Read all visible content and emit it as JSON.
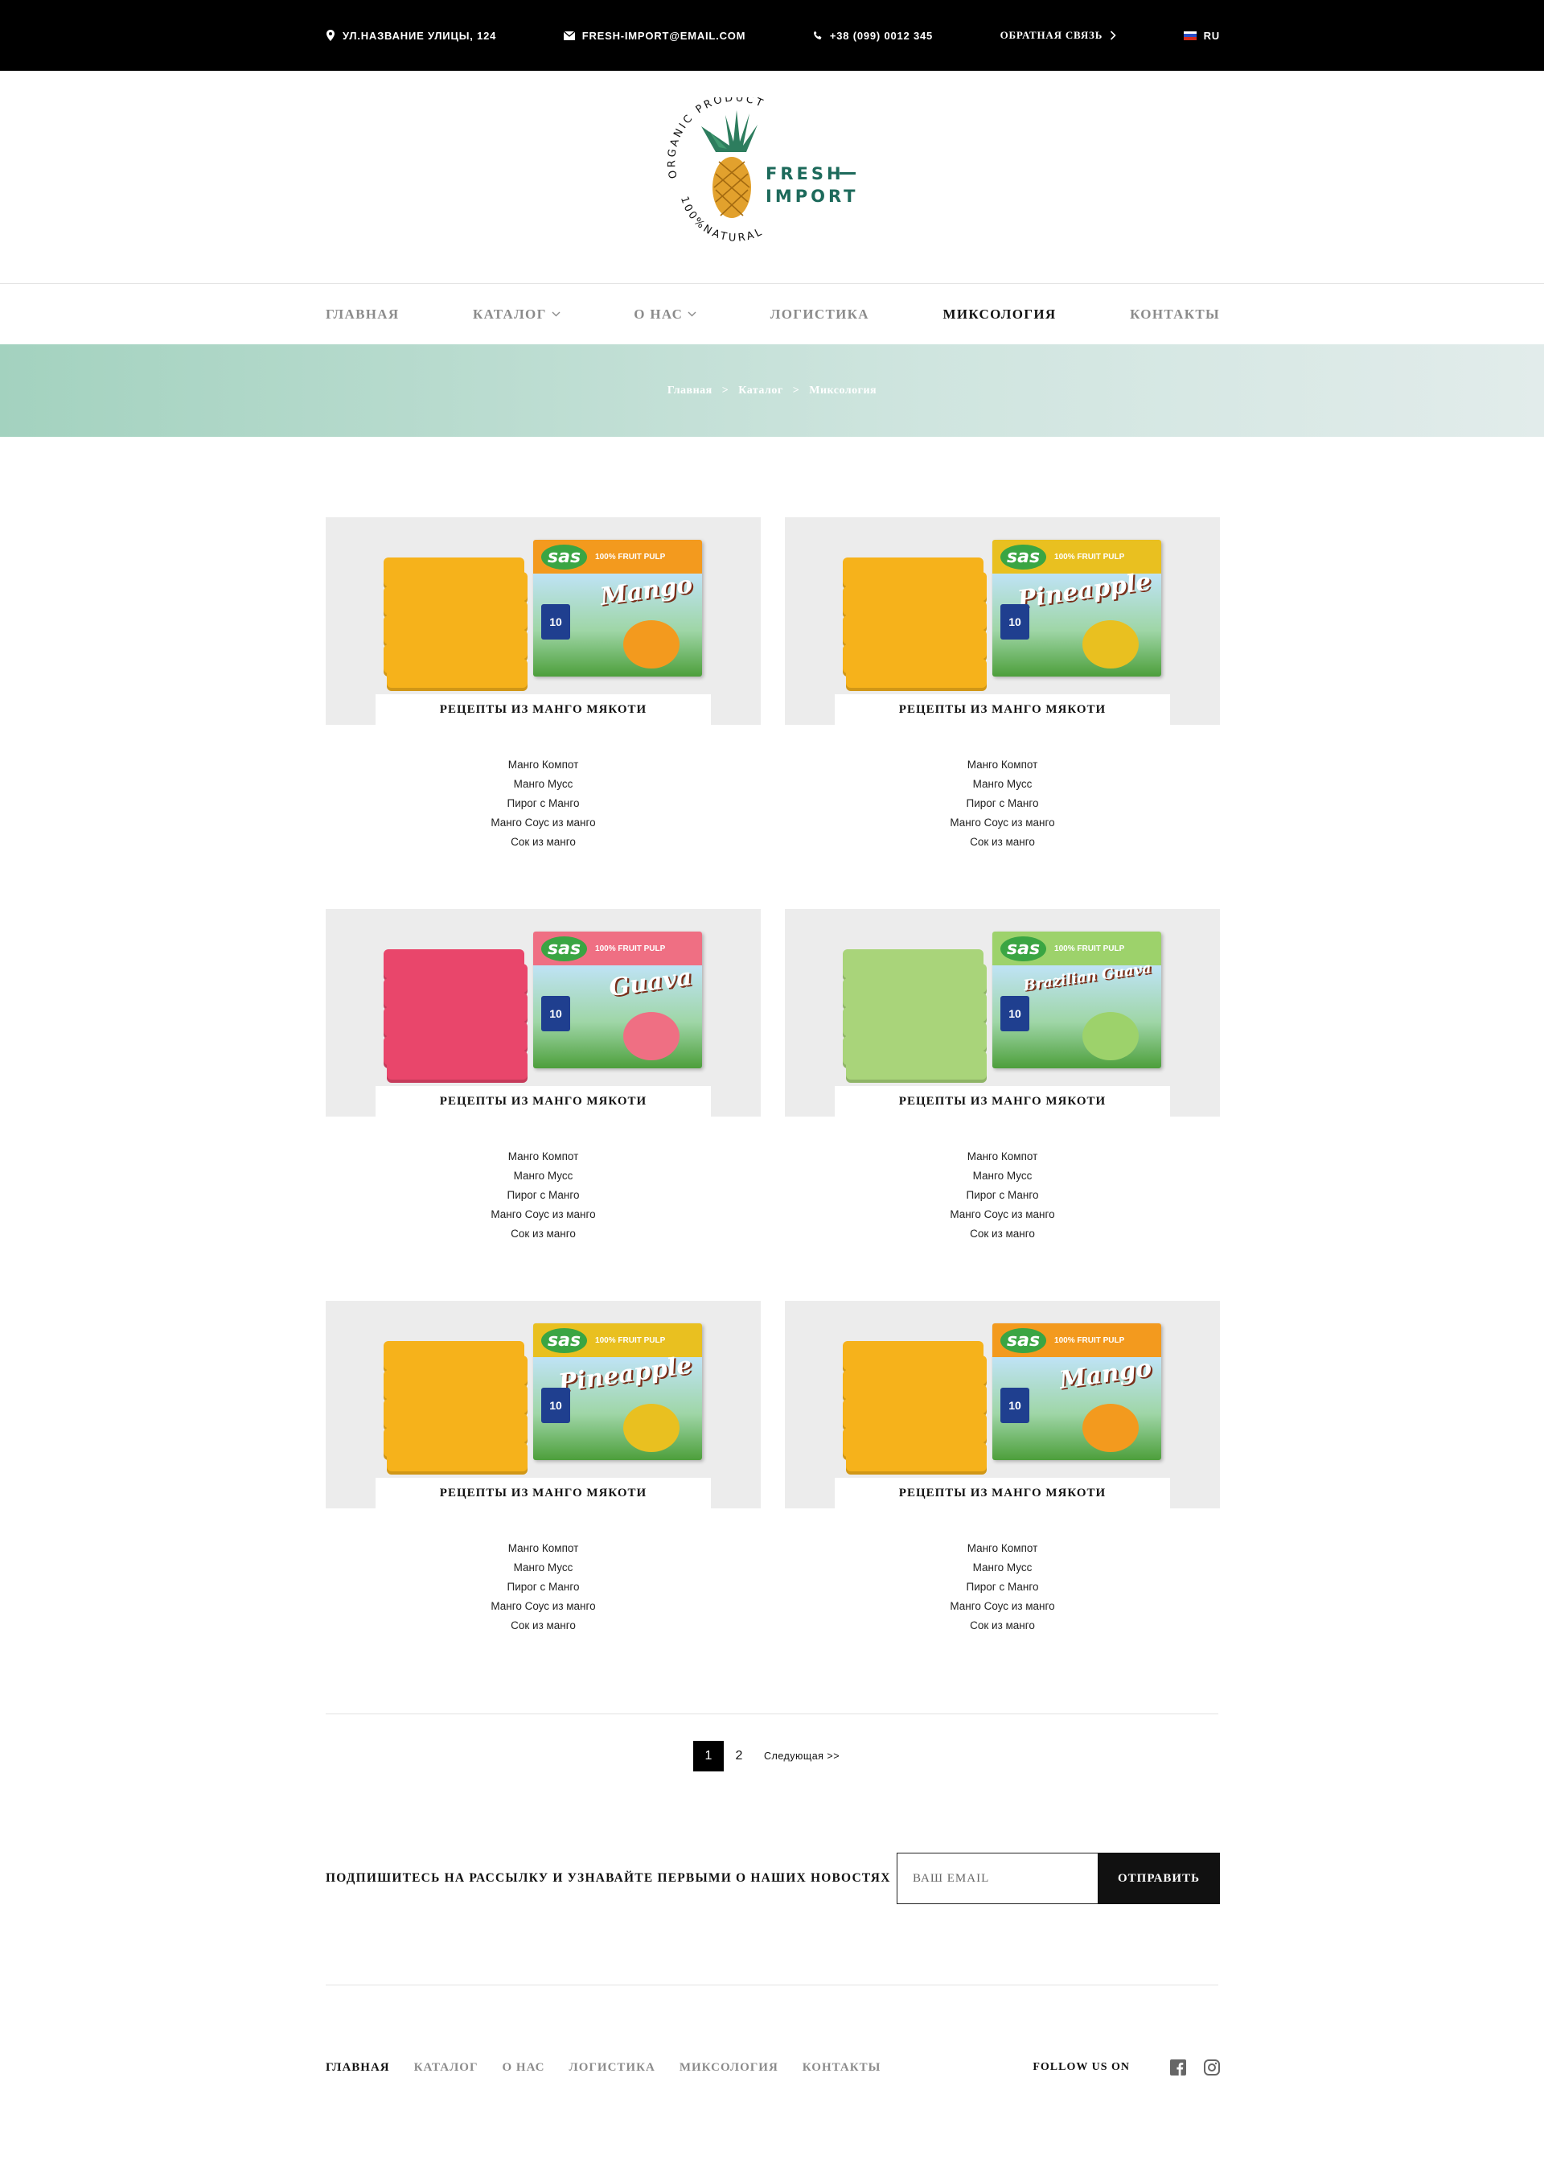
{
  "topbar": {
    "address": "УЛ.НАЗВАНИЕ УЛИЦЫ, 124",
    "email": "FRESH-IMPORT@EMAIL.COM",
    "phone": "+38 (099) 0012 345",
    "feedback": "ОБРАТНАЯ СВЯЗЬ",
    "lang": "RU"
  },
  "logo": {
    "arc_top": "ORGANIC PRODUCT",
    "arc_bottom": "100%NATURAL",
    "word1": "FRESH",
    "word2": "IMPORT"
  },
  "nav": {
    "items": [
      "ГЛАВНАЯ",
      "КАТАЛОГ",
      "О НАС",
      "ЛОГИСТИКА",
      "МИКСОЛОГИЯ",
      "КОНТАКТЫ"
    ],
    "active": "МИКСОЛОГИЯ"
  },
  "breadcrumb": [
    "Главная",
    ">",
    "Каталог",
    ">",
    "Миксология"
  ],
  "cards": [
    {
      "title": "РЕЦЕПТЫ ИЗ МАНГО МЯКОТИ",
      "flavor": "Mango",
      "pouch_color": "#f6b21b",
      "fruit_color": "#f39a1e",
      "recipes": [
        "Манго Компот",
        "Манго Мусс",
        "Пирог с Манго",
        "Манго Соус из манго",
        "Сок из манго"
      ]
    },
    {
      "title": "РЕЦЕПТЫ ИЗ МАНГО МЯКОТИ",
      "flavor": "Pineapple",
      "pouch_color": "#f6b21b",
      "fruit_color": "#e9c020",
      "recipes": [
        "Манго Компот",
        "Манго Мусс",
        "Пирог с Манго",
        "Манго Соус из манго",
        "Сок из манго"
      ]
    },
    {
      "title": "РЕЦЕПТЫ ИЗ МАНГО МЯКОТИ",
      "flavor": "Guava",
      "pouch_color": "#e9466b",
      "fruit_color": "#ef6f83",
      "recipes": [
        "Манго Компот",
        "Манго Мусс",
        "Пирог с Манго",
        "Манго Соус из манго",
        "Сок из манго"
      ]
    },
    {
      "title": "РЕЦЕПТЫ ИЗ МАНГО МЯКОТИ",
      "flavor": "Brazilian Guava",
      "pouch_color": "#a9d47a",
      "fruit_color": "#9dd26b",
      "recipes": [
        "Манго Компот",
        "Манго Мусс",
        "Пирог с Манго",
        "Манго Соус из манго",
        "Сок из манго"
      ]
    },
    {
      "title": "РЕЦЕПТЫ ИЗ МАНГО МЯКОТИ",
      "flavor": "Pineapple",
      "pouch_color": "#f6b21b",
      "fruit_color": "#e9c020",
      "recipes": [
        "Манго Компот",
        "Манго Мусс",
        "Пирог с Манго",
        "Манго Соус из манго",
        "Сок из манго"
      ]
    },
    {
      "title": "РЕЦЕПТЫ ИЗ МАНГО МЯКОТИ",
      "flavor": "Mango",
      "pouch_color": "#f6b21b",
      "fruit_color": "#f39a1e",
      "recipes": [
        "Манго Компот",
        "Манго Мусс",
        "Пирог с Манго",
        "Манго Соус из манго",
        "Сок из манго"
      ]
    }
  ],
  "product_box": {
    "brand": "sas",
    "claim": "100% FRUIT PULP",
    "badge": "10"
  },
  "pagination": {
    "pages": [
      "1",
      "2"
    ],
    "active": "1",
    "next": "Следующая >>"
  },
  "subscribe": {
    "text": "ПОДПИШИТЕСЬ НА РАССЫЛКУ И УЗНАВАЙТЕ ПЕРВЫМИ О НАШИХ НОВОСТЯХ",
    "placeholder": "ВАШ EMAIL",
    "button": "ОТПРАВИТЬ"
  },
  "footer": {
    "links": [
      "ГЛАВНАЯ",
      "КАТАЛОГ",
      "О НАС",
      "ЛОГИСТИКА",
      "МИКСОЛОГИЯ",
      "КОНТАКТЫ"
    ],
    "active": "ГЛАВНАЯ",
    "follow": "FOLLOW US ON",
    "icons": [
      "facebook-icon",
      "instagram-icon"
    ]
  },
  "colors": {
    "accent_band_start": "#a3d2bf",
    "accent_band_end": "#e2eceb",
    "logo_green": "#1d6a5b",
    "topbar": "#000000"
  }
}
